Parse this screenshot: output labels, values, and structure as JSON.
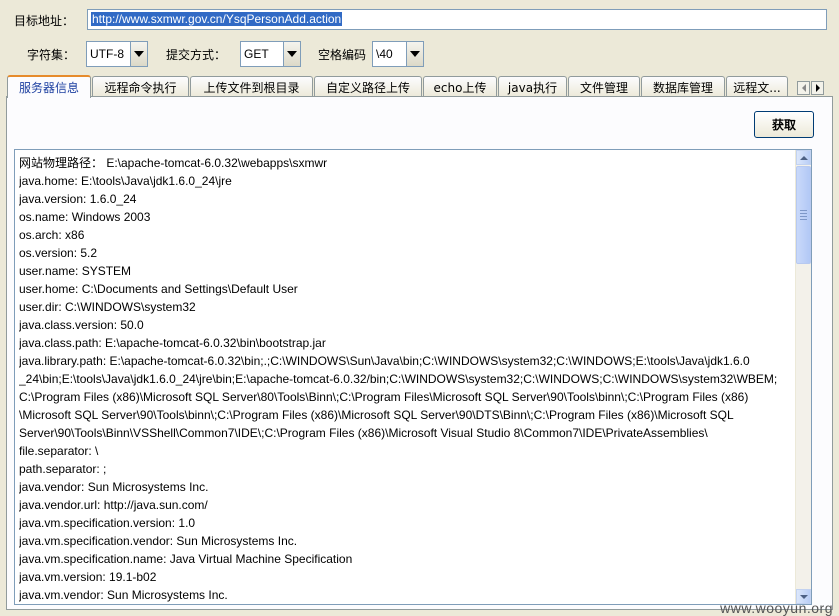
{
  "target": {
    "label": "目标地址：",
    "value": "http://www.sxmwr.gov.cn/YsqPersonAdd.action"
  },
  "options": {
    "charset_label": "字符集：",
    "charset_value": "UTF-8",
    "method_label": "提交方式：",
    "method_value": "GET",
    "space_label": "空格编码",
    "space_value": "\\40"
  },
  "tabs": [
    {
      "label": "服务器信息"
    },
    {
      "label": "远程命令执行"
    },
    {
      "label": "上传文件到根目录"
    },
    {
      "label": "自定义路径上传"
    },
    {
      "label": "echo上传"
    },
    {
      "label": "java执行"
    },
    {
      "label": "文件管理"
    },
    {
      "label": "数据库管理"
    },
    {
      "label": "远程文..."
    }
  ],
  "fetch_label": "获取",
  "output_lines": [
    "网站物理路径： E:\\apache-tomcat-6.0.32\\webapps\\sxmwr",
    "java.home: E:\\tools\\Java\\jdk1.6.0_24\\jre",
    "java.version: 1.6.0_24",
    "os.name: Windows 2003",
    "os.arch: x86",
    "os.version: 5.2",
    "user.name: SYSTEM",
    "user.home: C:\\Documents and Settings\\Default User",
    "user.dir: C:\\WINDOWS\\system32",
    "java.class.version: 50.0",
    "java.class.path: E:\\apache-tomcat-6.0.32\\bin\\bootstrap.jar",
    "java.library.path: E:\\apache-tomcat-6.0.32\\bin;.;C:\\WINDOWS\\Sun\\Java\\bin;C:\\WINDOWS\\system32;C:\\WINDOWS;E:\\tools\\Java\\jdk1.6.0",
    "_24\\bin;E:\\tools\\Java\\jdk1.6.0_24\\jre\\bin;E:\\apache-tomcat-6.0.32/bin;C:\\WINDOWS\\system32;C:\\WINDOWS;C:\\WINDOWS\\system32\\WBEM;",
    "C:\\Program Files (x86)\\Microsoft SQL Server\\80\\Tools\\Binn\\;C:\\Program Files\\Microsoft SQL Server\\90\\Tools\\binn\\;C:\\Program Files (x86)",
    "\\Microsoft SQL Server\\90\\Tools\\binn\\;C:\\Program Files (x86)\\Microsoft SQL Server\\90\\DTS\\Binn\\;C:\\Program Files (x86)\\Microsoft SQL",
    "Server\\90\\Tools\\Binn\\VSShell\\Common7\\IDE\\;C:\\Program Files (x86)\\Microsoft Visual Studio 8\\Common7\\IDE\\PrivateAssemblies\\",
    "file.separator: \\",
    "path.separator: ;",
    "java.vendor: Sun Microsystems Inc.",
    "java.vendor.url: http://java.sun.com/",
    "java.vm.specification.version: 1.0",
    "java.vm.specification.vendor: Sun Microsystems Inc.",
    "java.vm.specification.name: Java Virtual Machine Specification",
    "java.vm.version: 19.1-b02",
    "java.vm.vendor: Sun Microsystems Inc."
  ],
  "watermark": "www.wooyun.org"
}
